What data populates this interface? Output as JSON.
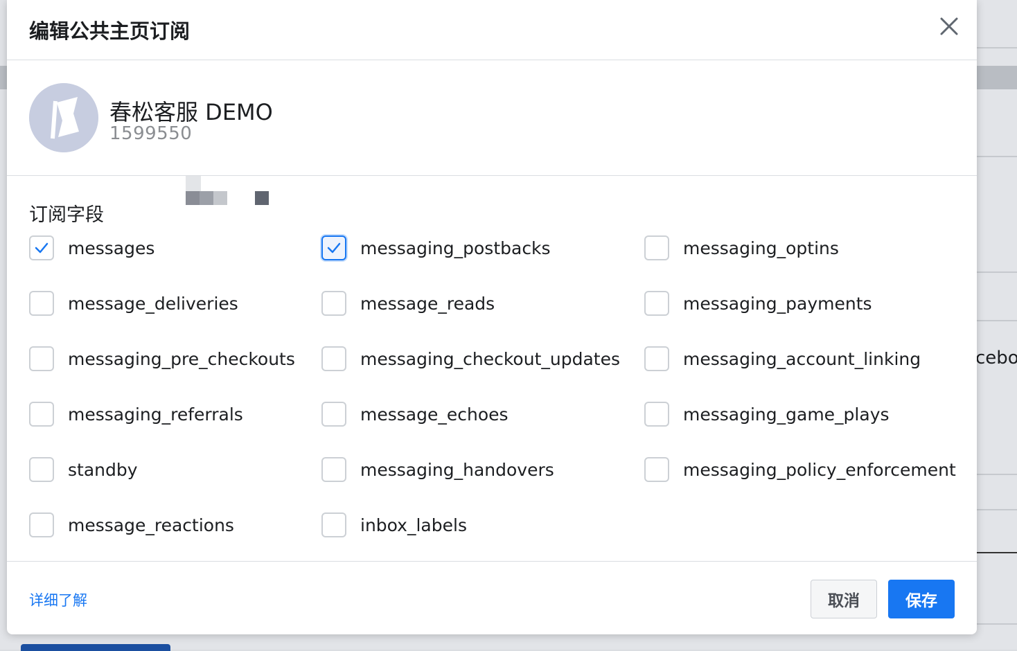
{
  "dialog": {
    "title": "编辑公共主页订阅",
    "close_icon": "close-icon"
  },
  "page": {
    "name": "春松客服 DEMO",
    "id_visible": "1599550",
    "avatar_icon": "flag-icon"
  },
  "subscription": {
    "label": "订阅字段",
    "fields": [
      {
        "label": "messages",
        "checked": true
      },
      {
        "label": "messaging_postbacks",
        "checked": true
      },
      {
        "label": "messaging_optins",
        "checked": false
      },
      {
        "label": "message_deliveries",
        "checked": false
      },
      {
        "label": "message_reads",
        "checked": false
      },
      {
        "label": "messaging_payments",
        "checked": false
      },
      {
        "label": "messaging_pre_checkouts",
        "checked": false
      },
      {
        "label": "messaging_checkout_updates",
        "checked": false
      },
      {
        "label": "messaging_account_linking",
        "checked": false
      },
      {
        "label": "messaging_referrals",
        "checked": false
      },
      {
        "label": "message_echoes",
        "checked": false
      },
      {
        "label": "messaging_game_plays",
        "checked": false
      },
      {
        "label": "standby",
        "checked": false
      },
      {
        "label": "messaging_handovers",
        "checked": false
      },
      {
        "label": "messaging_policy_enforcement",
        "checked": false
      },
      {
        "label": "message_reactions",
        "checked": false
      },
      {
        "label": "inbox_labels",
        "checked": false
      }
    ]
  },
  "footer": {
    "learn_more": "详细了解",
    "cancel_label": "取消",
    "save_label": "保存"
  },
  "background": {
    "partial_text": "cebo"
  },
  "colors": {
    "accent": "#1877f2",
    "border": "#ccd0d5"
  }
}
